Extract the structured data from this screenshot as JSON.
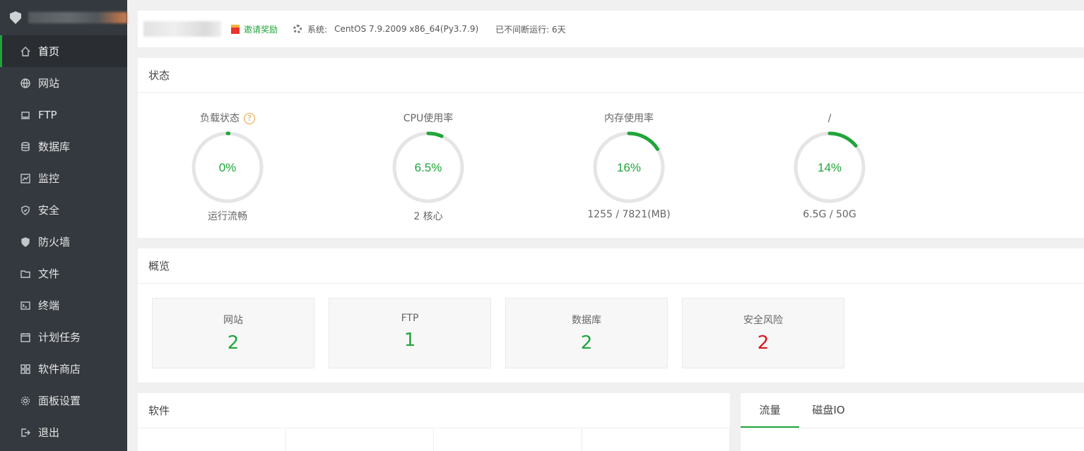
{
  "sidebar": {
    "items": [
      {
        "label": "首页",
        "icon": "home-icon"
      },
      {
        "label": "网站",
        "icon": "globe-icon"
      },
      {
        "label": "FTP",
        "icon": "ftp-icon"
      },
      {
        "label": "数据库",
        "icon": "database-icon"
      },
      {
        "label": "监控",
        "icon": "monitor-icon"
      },
      {
        "label": "安全",
        "icon": "shield-check-icon"
      },
      {
        "label": "防火墙",
        "icon": "firewall-icon"
      },
      {
        "label": "文件",
        "icon": "folder-icon"
      },
      {
        "label": "终端",
        "icon": "terminal-icon"
      },
      {
        "label": "计划任务",
        "icon": "calendar-icon"
      },
      {
        "label": "软件商店",
        "icon": "grid-icon"
      },
      {
        "label": "面板设置",
        "icon": "gear-icon"
      },
      {
        "label": "退出",
        "icon": "logout-icon"
      }
    ]
  },
  "topbar": {
    "invite": "邀请奖励",
    "system_label": "系统:",
    "system_value": "CentOS 7.9.2009 x86_64(Py3.7.9)",
    "uptime": "已不间断运行: 6天"
  },
  "status": {
    "title": "状态",
    "gauges": [
      {
        "label": "负载状态",
        "value": "0%",
        "percent": 0,
        "sub": "运行流畅",
        "help": "?"
      },
      {
        "label": "CPU使用率",
        "value": "6.5%",
        "percent": 6.5,
        "sub": "2 核心"
      },
      {
        "label": "内存使用率",
        "value": "16%",
        "percent": 16,
        "sub": "1255 / 7821(MB)"
      },
      {
        "label": "/",
        "value": "14%",
        "percent": 14,
        "sub": "6.5G / 50G"
      }
    ]
  },
  "overview": {
    "title": "概览",
    "items": [
      {
        "label": "网站",
        "value": "2"
      },
      {
        "label": "FTP",
        "value": "1"
      },
      {
        "label": "数据库",
        "value": "2"
      },
      {
        "label": "安全风险",
        "value": "2"
      }
    ]
  },
  "software": {
    "title": "软件"
  },
  "traffic": {
    "tabs": [
      "流量",
      "磁盘IO"
    ]
  },
  "colors": {
    "accent": "#20a53a",
    "danger": "#d9161b",
    "sidebar_bg": "#34393f",
    "ring": "#e5e5e5"
  }
}
